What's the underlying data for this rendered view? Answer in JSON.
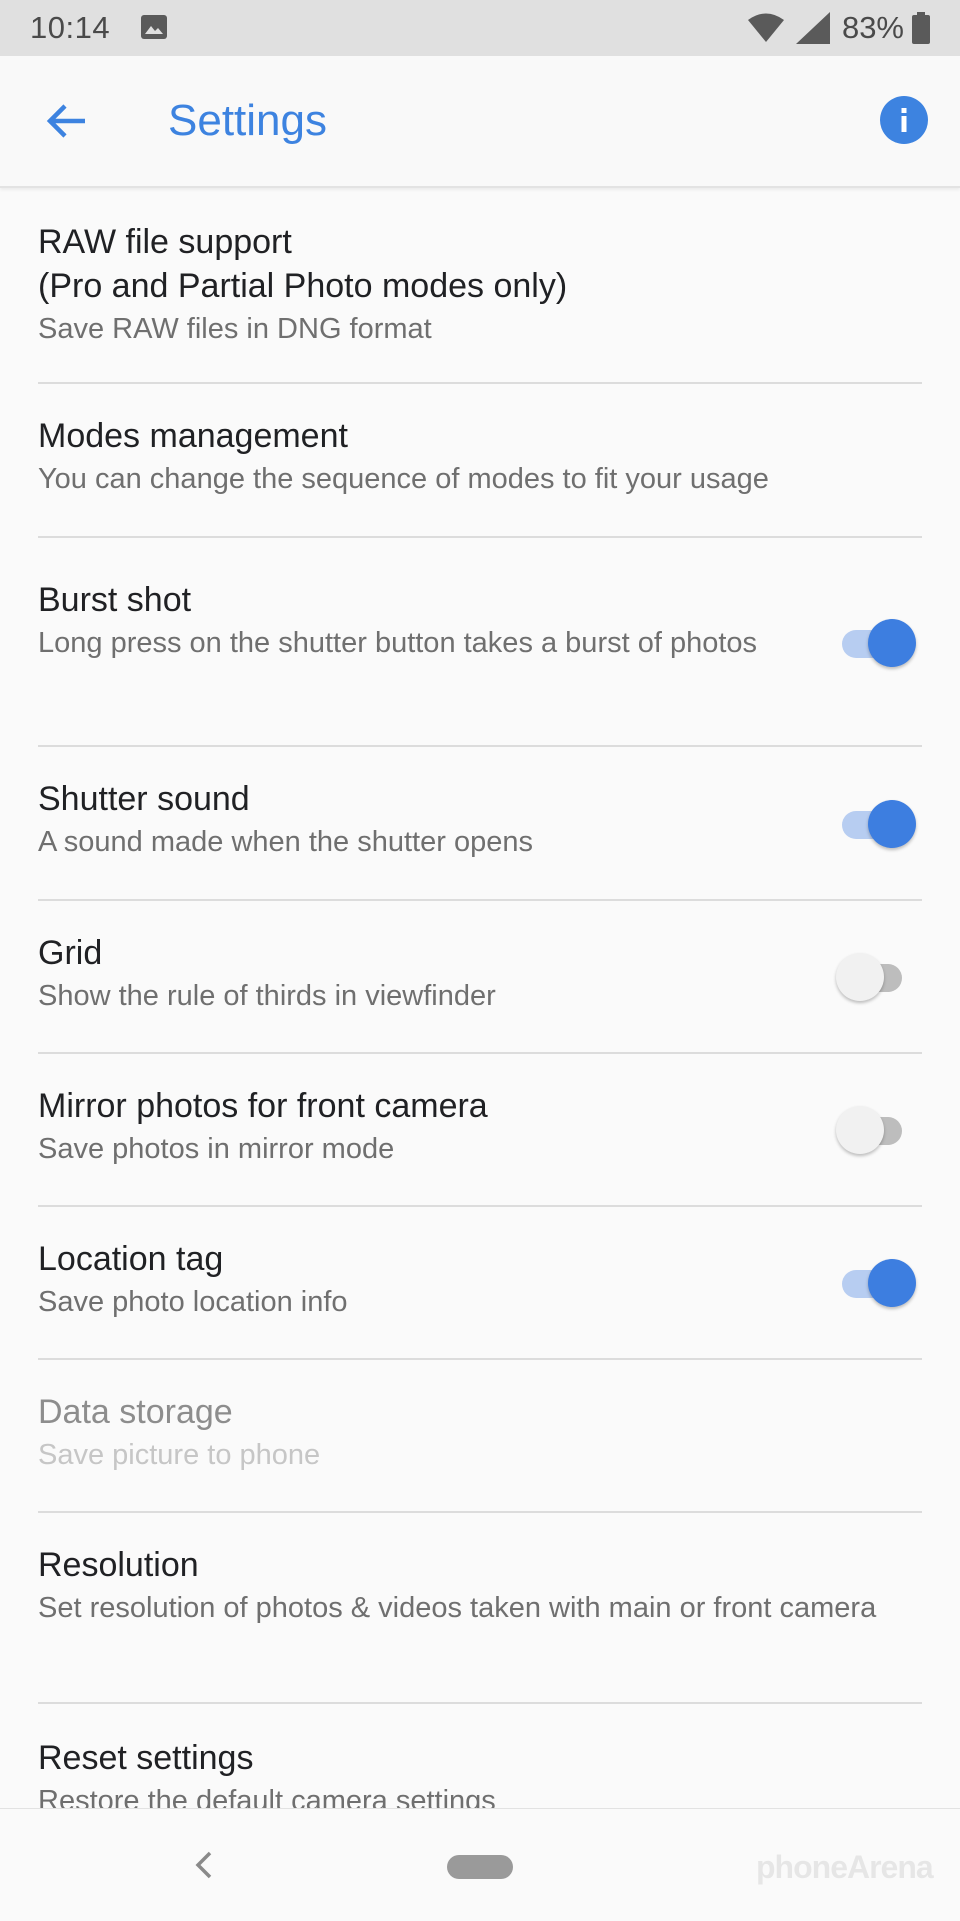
{
  "status_bar": {
    "time": "10:14",
    "battery_percent": "83%",
    "icons": [
      "image-icon",
      "wifi-icon",
      "signal-icon",
      "battery-icon"
    ]
  },
  "app_bar": {
    "title": "Settings",
    "back_icon": "arrow-back-icon",
    "info_icon": "info-icon",
    "accent_color": "#3d83e0"
  },
  "settings": {
    "raw": {
      "title": "RAW file support\n(Pro and Partial Photo modes only)",
      "summary": "Save RAW files in DNG format"
    },
    "modes": {
      "title": "Modes management",
      "summary": "You can change the sequence of modes to fit your usage"
    },
    "burst": {
      "title": "Burst shot",
      "summary": "Long press on the shutter button takes a burst of photos",
      "enabled": true
    },
    "shutter": {
      "title": "Shutter sound",
      "summary": "A sound made when the shutter opens",
      "enabled": true
    },
    "grid": {
      "title": "Grid",
      "summary": "Show the rule of thirds in viewfinder",
      "enabled": false
    },
    "mirror": {
      "title": "Mirror photos for front camera",
      "summary": "Save photos in mirror mode",
      "enabled": false
    },
    "location": {
      "title": "Location tag",
      "summary": "Save photo location info",
      "enabled": true
    },
    "storage": {
      "title": "Data storage",
      "summary": "Save picture to phone",
      "disabled_row": true
    },
    "resolution": {
      "title": "Resolution",
      "summary": "Set resolution of photos & videos taken with main or front camera"
    },
    "reset": {
      "title": "Reset settings",
      "summary": "Restore the default camera settings"
    }
  },
  "nav_bar": {
    "watermark": "phoneArena"
  }
}
